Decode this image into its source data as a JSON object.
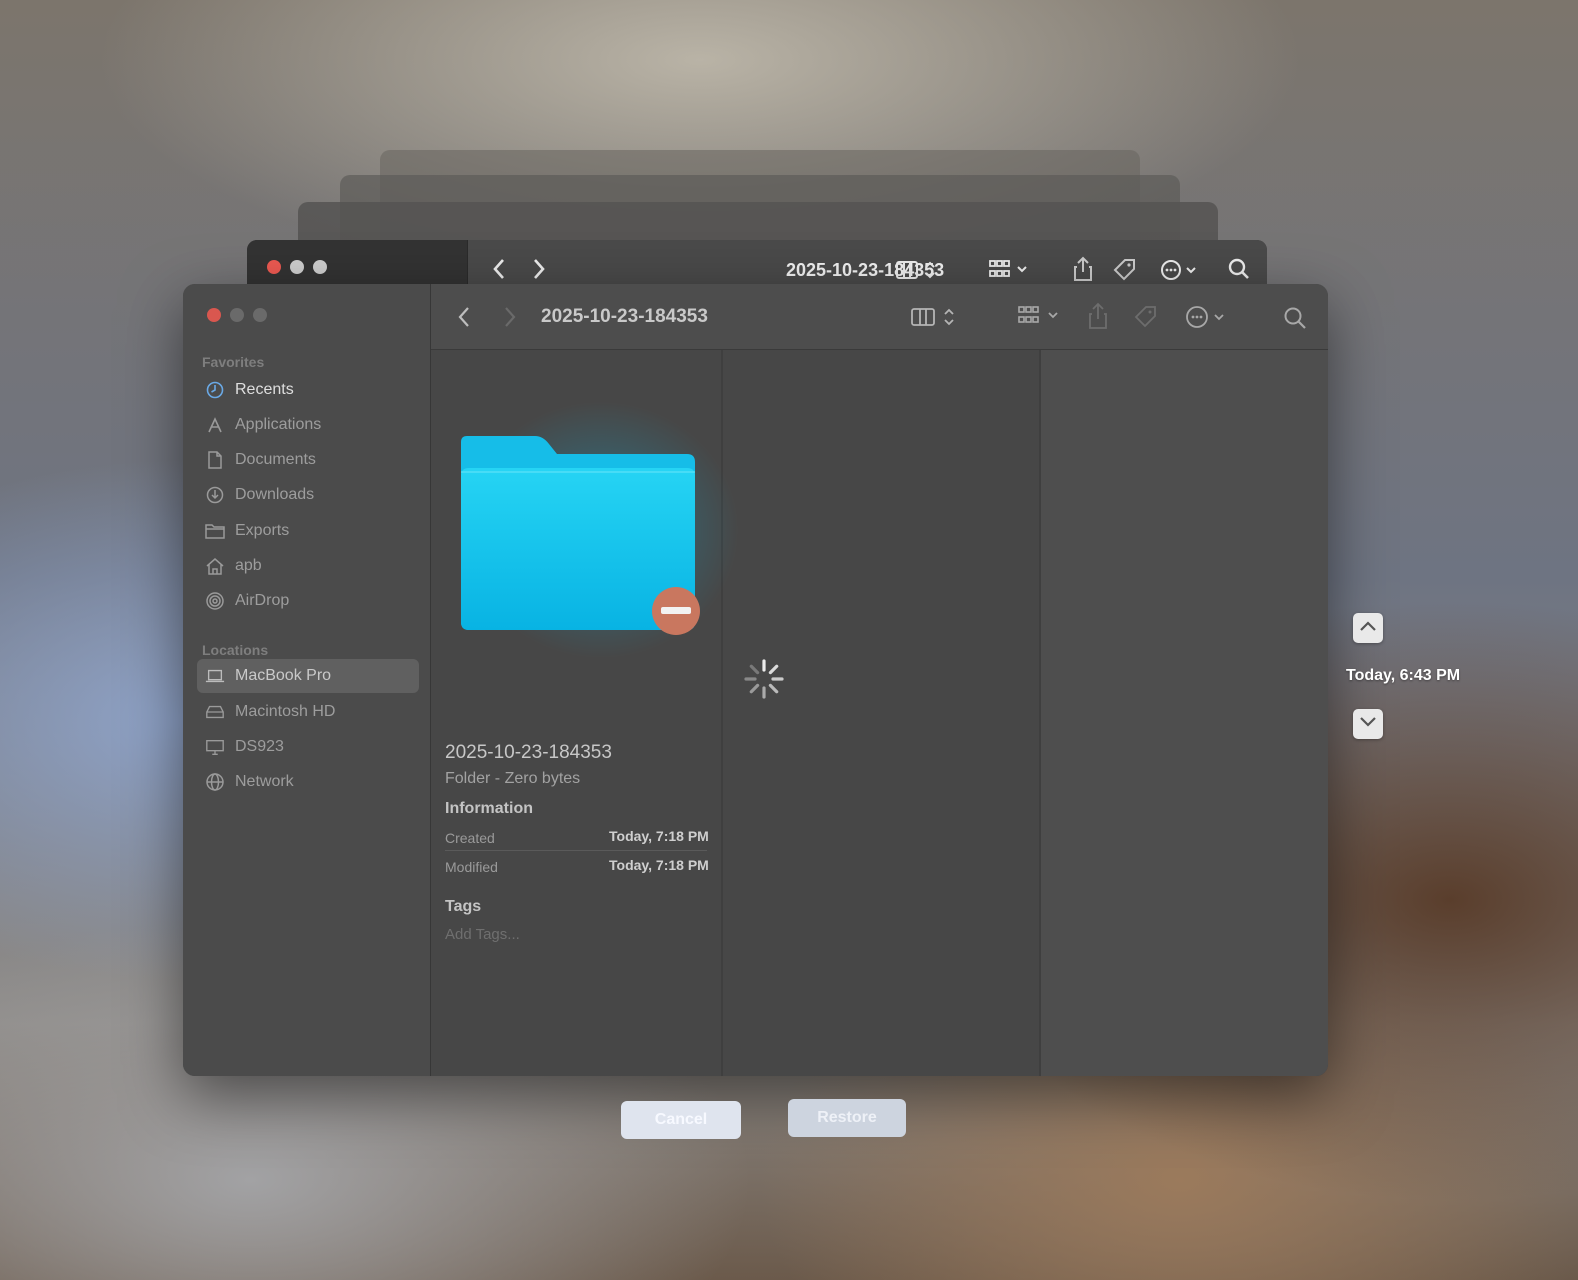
{
  "colors": {
    "close": "#ee5a52",
    "minimize": "#bdbdbd",
    "zoom": "#bdbdbd",
    "folder": "#18c6ec",
    "accent": "#00b8e6"
  },
  "back_window": {
    "title": "2025-10-23-184353"
  },
  "window": {
    "title": "2025-10-23-184353",
    "toolbar_icons": [
      "chevron-left-icon",
      "chevron-right-icon",
      "column-view-icon",
      "group-icon",
      "share-icon",
      "tag-icon",
      "more-icon",
      "search-icon"
    ]
  },
  "sidebar": {
    "favorites_heading": "Favorites",
    "favorites": [
      {
        "label": "Recents",
        "icon": "clock-icon"
      },
      {
        "label": "Applications",
        "icon": "applications-icon"
      },
      {
        "label": "Documents",
        "icon": "document-icon"
      },
      {
        "label": "Downloads",
        "icon": "download-icon"
      },
      {
        "label": "Exports",
        "icon": "folder-icon"
      },
      {
        "label": "apb",
        "icon": "home-icon"
      },
      {
        "label": "AirDrop",
        "icon": "airdrop-icon"
      }
    ],
    "locations_heading": "Locations",
    "locations": [
      {
        "label": "MacBook Pro",
        "icon": "laptop-icon"
      },
      {
        "label": "Macintosh HD",
        "icon": "disk-icon"
      },
      {
        "label": "DS923",
        "icon": "display-icon"
      },
      {
        "label": "Network",
        "icon": "globe-icon"
      }
    ]
  },
  "preview": {
    "name": "2025-10-23-184353",
    "kind": "Folder - Zero bytes",
    "information_heading": "Information",
    "created_label": "Created",
    "created_value": "Today, 7:18 PM",
    "modified_label": "Modified",
    "modified_value": "Today, 7:18 PM",
    "tags_heading": "Tags",
    "tags_placeholder": "Add Tags..."
  },
  "timeline": {
    "date": "Today, 6:43 PM"
  },
  "buttons": {
    "cancel": "Cancel",
    "restore": "Restore"
  }
}
